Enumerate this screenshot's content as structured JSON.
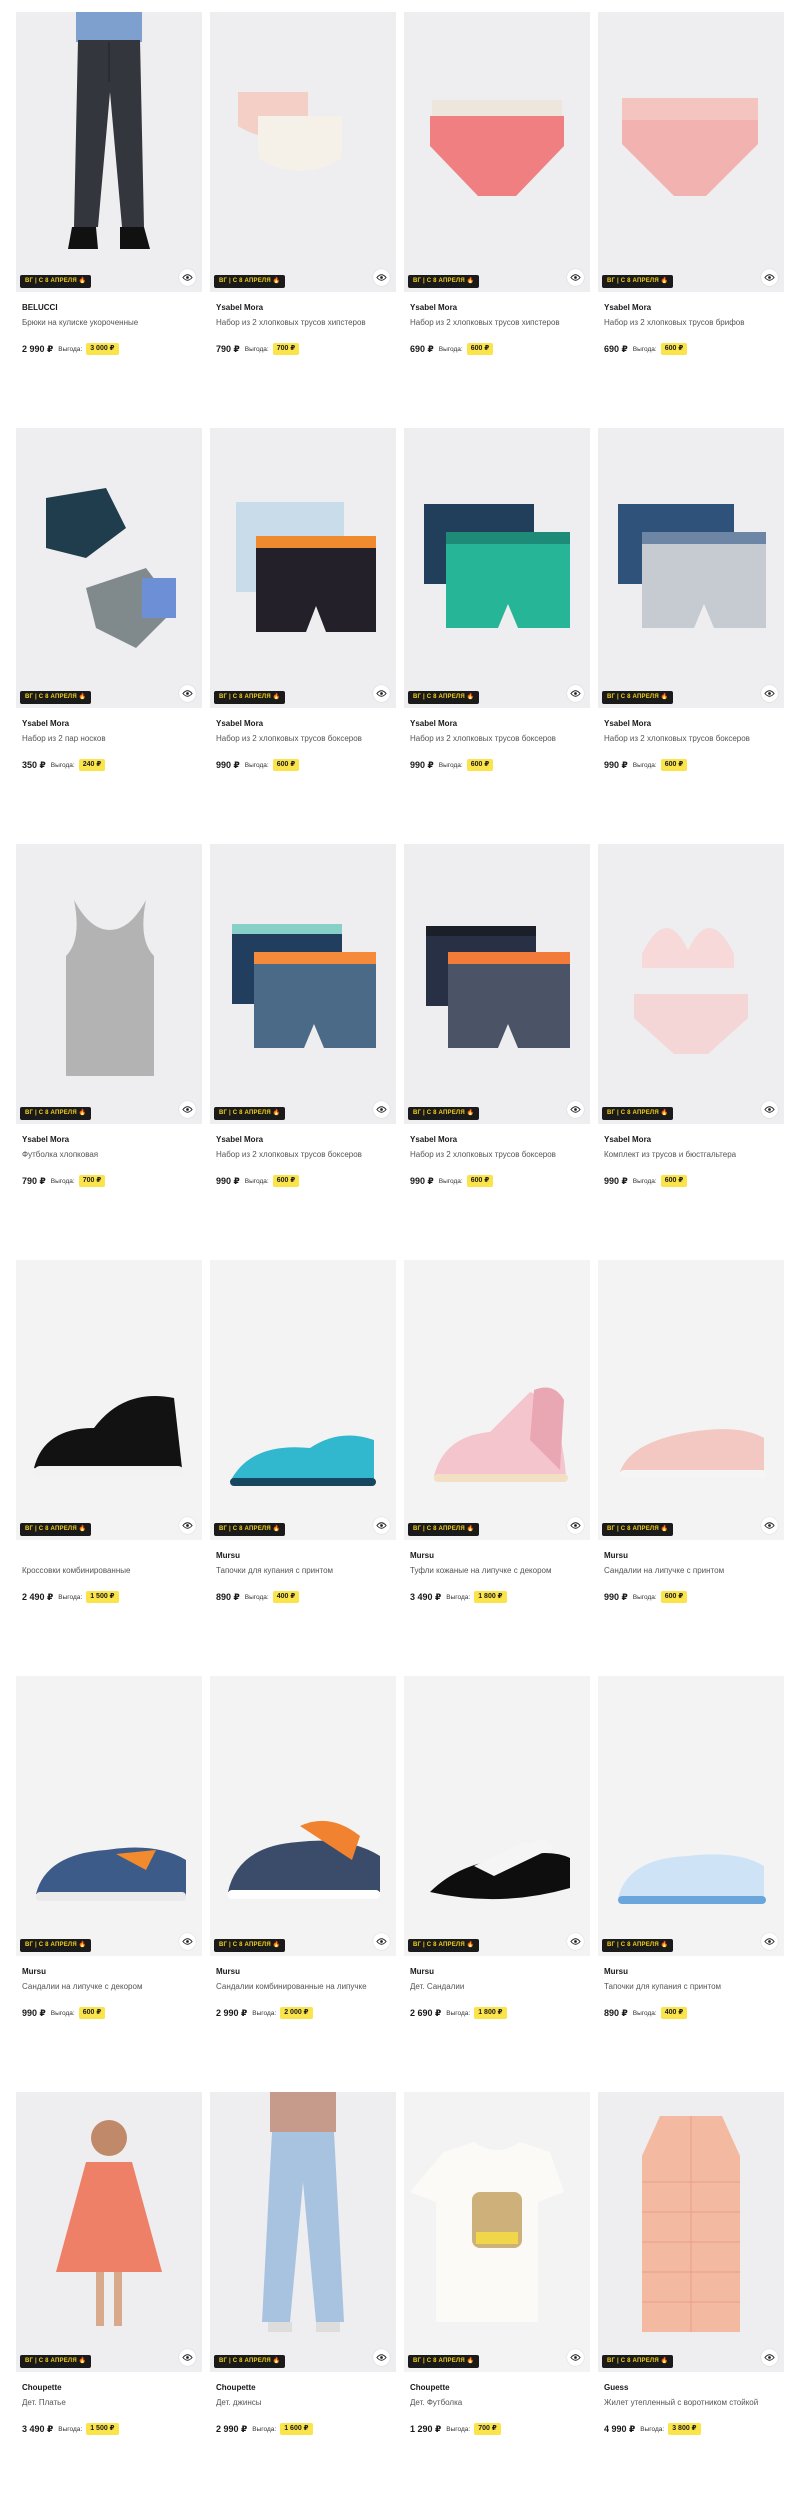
{
  "promo_label": "ВГ | С 8 АПРЕЛЯ 🔥",
  "gain_label": "Выгода:",
  "products": [
    {
      "brand": "BELUCCI",
      "title": "Брюки на кулиске укороченные",
      "price": "2 990 ₽",
      "gain": "3 000 ₽",
      "image": "pants"
    },
    {
      "brand": "Ysabel Mora",
      "title": "Набор из 2 хлопковых трусов хипстеров",
      "price": "790 ₽",
      "gain": "700 ₽",
      "image": "hipsters-light"
    },
    {
      "brand": "Ysabel Mora",
      "title": "Набор из 2 хлопковых трусов хипстеров",
      "price": "690 ₽",
      "gain": "600 ₽",
      "image": "hipsters-pink"
    },
    {
      "brand": "Ysabel Mora",
      "title": "Набор из 2 хлопковых трусов брифов",
      "price": "690 ₽",
      "gain": "600 ₽",
      "image": "briefs-pink"
    },
    {
      "brand": "Ysabel Mora",
      "title": "Набор из 2 пар носков",
      "price": "350 ₽",
      "gain": "240 ₽",
      "image": "socks"
    },
    {
      "brand": "Ysabel Mora",
      "title": "Набор из 2 хлопковых трусов боксеров",
      "price": "990 ₽",
      "gain": "600 ₽",
      "image": "boxers-orange"
    },
    {
      "brand": "Ysabel Mora",
      "title": "Набор из 2 хлопковых трусов боксеров",
      "price": "990 ₽",
      "gain": "600 ₽",
      "image": "boxers-green"
    },
    {
      "brand": "Ysabel Mora",
      "title": "Набор из 2 хлопковых трусов боксеров",
      "price": "990 ₽",
      "gain": "600 ₽",
      "image": "boxers-grey"
    },
    {
      "brand": "Ysabel Mora",
      "title": "Футболка хлопковая",
      "price": "790 ₽",
      "gain": "700 ₽",
      "image": "tank"
    },
    {
      "brand": "Ysabel Mora",
      "title": "Набор из 2 хлопковых трусов боксеров",
      "price": "990 ₽",
      "gain": "600 ₽",
      "image": "boxers-blue-orange"
    },
    {
      "brand": "Ysabel Mora",
      "title": "Набор из 2 хлопковых трусов боксеров",
      "price": "990 ₽",
      "gain": "600 ₽",
      "image": "boxers-dark"
    },
    {
      "brand": "Ysabel Mora",
      "title": "Комплект из трусов и бюстгальтера",
      "price": "990 ₽",
      "gain": "600 ₽",
      "image": "bra-set"
    },
    {
      "brand": "",
      "title": "Кроссовки комбинированные",
      "price": "2 490 ₽",
      "gain": "1 500 ₽",
      "image": "sneakers-black"
    },
    {
      "brand": "Mursu",
      "title": "Тапочки для купания с принтом",
      "price": "890 ₽",
      "gain": "400 ₽",
      "image": "aqua-blue"
    },
    {
      "brand": "Mursu",
      "title": "Туфли кожаные на липучке с декором",
      "price": "3 490 ₽",
      "gain": "1 800 ₽",
      "image": "shoes-pink"
    },
    {
      "brand": "Mursu",
      "title": "Сандалии на липучке с принтом",
      "price": "990 ₽",
      "gain": "600 ₽",
      "image": "sandals-pink"
    },
    {
      "brand": "Mursu",
      "title": "Сандалии на липучке с декором",
      "price": "990 ₽",
      "gain": "600 ₽",
      "image": "sandals-denim"
    },
    {
      "brand": "Mursu",
      "title": "Сандалии комбинированные на липучке",
      "price": "2 990 ₽",
      "gain": "2 000 ₽",
      "image": "sandals-orange"
    },
    {
      "brand": "Mursu",
      "title": "Дет. Сандалии",
      "price": "2 690 ₽",
      "gain": "1 800 ₽",
      "image": "sandals-black"
    },
    {
      "brand": "Mursu",
      "title": "Тапочки для купания с принтом",
      "price": "890 ₽",
      "gain": "400 ₽",
      "image": "aqua-white"
    },
    {
      "brand": "Choupette",
      "title": "Дет. Платье",
      "price": "3 490 ₽",
      "gain": "1 500 ₽",
      "image": "dress"
    },
    {
      "brand": "Choupette",
      "title": "Дет. джинсы",
      "price": "2 990 ₽",
      "gain": "1 600 ₽",
      "image": "jeans"
    },
    {
      "brand": "Choupette",
      "title": "Дет. Футболка",
      "price": "1 290 ₽",
      "gain": "700 ₽",
      "image": "tshirt"
    },
    {
      "brand": "Guess",
      "title": "Жилет утепленный с воротником стойкой",
      "price": "4 990 ₽",
      "gain": "3 800 ₽",
      "image": "vest"
    }
  ]
}
